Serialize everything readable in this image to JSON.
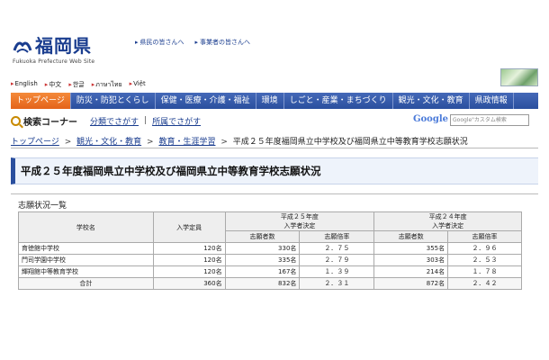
{
  "header": {
    "logo_text": "福岡県",
    "logo_sub": "Fukuoka Prefecture Web Site",
    "top_links": [
      "県民の皆さんへ",
      "事業者の皆さんへ"
    ]
  },
  "languages": [
    "English",
    "中文",
    "한글",
    "ภาษาไทย",
    "Việt"
  ],
  "nav": {
    "items": [
      "トップページ",
      "防災・防犯とくらし",
      "保健・医療・介護・福祉",
      "環境",
      "しごと・産業・まちづくり",
      "観光・文化・教育",
      "県政情報"
    ],
    "active_index": 0
  },
  "search": {
    "label": "検索コーナー",
    "by_category": "分類でさがす",
    "separator": "|",
    "by_department": "所属でさがす",
    "google_label": "Google",
    "google_placeholder": "Google\"カスタム検索"
  },
  "breadcrumb": {
    "items": [
      "トップページ",
      "観光・文化・教育",
      "教育・生涯学習"
    ],
    "separator": ">",
    "current": "平成２５年度福岡県立中学校及び福岡県立中等教育学校志願状況"
  },
  "page_title": "平成２５年度福岡県立中学校及び福岡県立中等教育学校志願状況",
  "table": {
    "section_title": "志願状況一覧",
    "col_school": "学校名",
    "col_capacity": "入学定員",
    "group_2013": [
      "平成２５年度",
      "入学者決定"
    ],
    "group_2012": [
      "平成２４年度",
      "入学者決定"
    ],
    "col_applicants": "志願者数",
    "col_ratio": "志願倍率",
    "rows": [
      {
        "name": "育徳館中学校",
        "capacity": "120名",
        "app_2013": "330名",
        "ratio_2013": "２．７５",
        "app_2012": "355名",
        "ratio_2012": "２．９６"
      },
      {
        "name": "門司学園中学校",
        "capacity": "120名",
        "app_2013": "335名",
        "ratio_2013": "２．７９",
        "app_2012": "303名",
        "ratio_2012": "２．５３"
      },
      {
        "name": "輝翔館中等教育学校",
        "capacity": "120名",
        "app_2013": "167名",
        "ratio_2013": "１．３９",
        "app_2012": "214名",
        "ratio_2012": "１．７８"
      }
    ],
    "total": {
      "name": "合計",
      "capacity": "360名",
      "app_2013": "832名",
      "ratio_2013": "２．３１",
      "app_2012": "872名",
      "ratio_2012": "２．４２"
    }
  }
}
